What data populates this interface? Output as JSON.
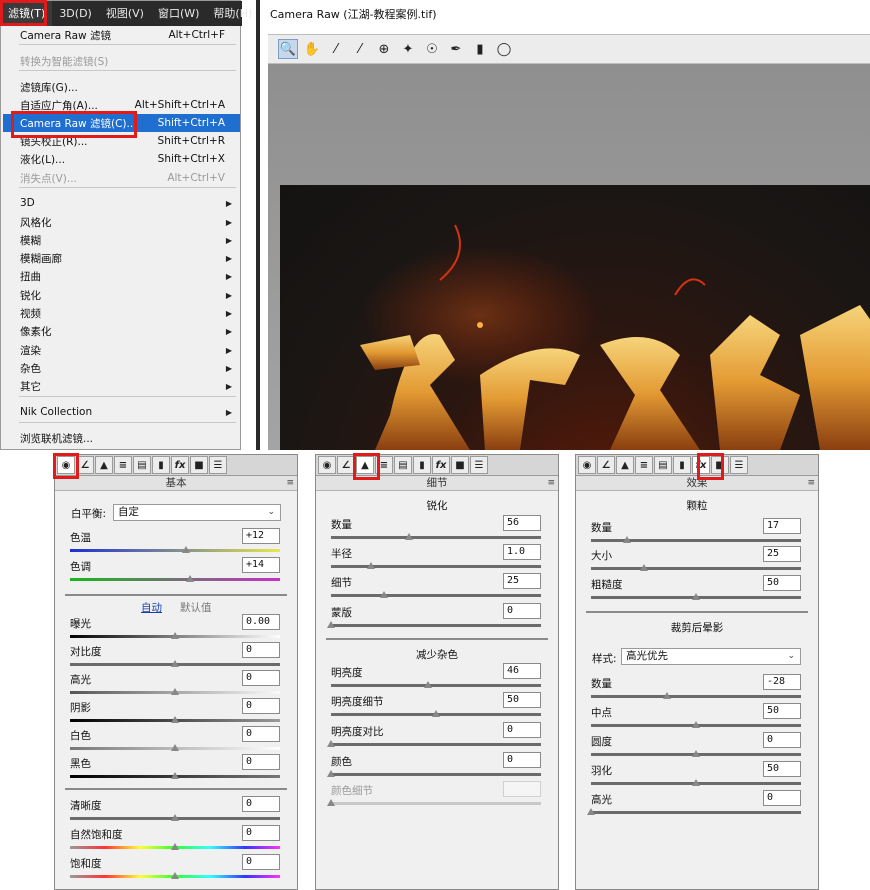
{
  "menubar": {
    "items": [
      "滤镜(T)",
      "3D(D)",
      "视图(V)",
      "窗口(W)",
      "帮助(H)"
    ]
  },
  "menu": {
    "items": [
      {
        "label": "Camera Raw 滤镜",
        "shortcut": "Alt+Ctrl+F",
        "state": "normal"
      },
      {
        "label": "转换为智能滤镜(S)",
        "shortcut": "",
        "state": "disabled"
      },
      {
        "label": "滤镜库(G)...",
        "shortcut": "",
        "state": "normal"
      },
      {
        "label": "自适应广角(A)...",
        "shortcut": "Alt+Shift+Ctrl+A",
        "state": "normal"
      },
      {
        "label": "Camera Raw 滤镜(C)...",
        "shortcut": "Shift+Ctrl+A",
        "state": "highlight"
      },
      {
        "label": "镜头校正(R)...",
        "shortcut": "Shift+Ctrl+R",
        "state": "normal"
      },
      {
        "label": "液化(L)...",
        "shortcut": "Shift+Ctrl+X",
        "state": "normal"
      },
      {
        "label": "消失点(V)...",
        "shortcut": "Alt+Ctrl+V",
        "state": "disabled"
      },
      {
        "label": "3D",
        "submenu": true
      },
      {
        "label": "风格化",
        "submenu": true
      },
      {
        "label": "模糊",
        "submenu": true
      },
      {
        "label": "模糊画廊",
        "submenu": true
      },
      {
        "label": "扭曲",
        "submenu": true
      },
      {
        "label": "锐化",
        "submenu": true
      },
      {
        "label": "视频",
        "submenu": true
      },
      {
        "label": "像素化",
        "submenu": true
      },
      {
        "label": "渲染",
        "submenu": true
      },
      {
        "label": "杂色",
        "submenu": true
      },
      {
        "label": "其它",
        "submenu": true
      },
      {
        "label": "Nik Collection",
        "submenu": true
      },
      {
        "label": "浏览联机滤镜..."
      }
    ]
  },
  "camera_raw": {
    "title": "Camera Raw (江湖-教程案例.tif)",
    "tools": [
      "zoom-icon",
      "hand-icon",
      "white-balance-icon",
      "color-sampler-icon",
      "target-adjust-icon",
      "crop-icon",
      "spot-removal-icon",
      "brush-icon",
      "graduated-filter-icon",
      "radial-filter-icon"
    ]
  },
  "panel_basic": {
    "title": "基本",
    "white_balance_label": "白平衡:",
    "white_balance_value": "自定",
    "auto_label": "自动",
    "default_label": "默认值",
    "sliders": [
      {
        "label": "色温",
        "value": "+12",
        "pos": 0.55
      },
      {
        "label": "色调",
        "value": "+14",
        "pos": 0.57
      },
      {
        "label": "曝光",
        "value": "0.00",
        "pos": 0.5
      },
      {
        "label": "对比度",
        "value": "0",
        "pos": 0.5
      },
      {
        "label": "高光",
        "value": "0",
        "pos": 0.5
      },
      {
        "label": "阴影",
        "value": "0",
        "pos": 0.5
      },
      {
        "label": "白色",
        "value": "0",
        "pos": 0.5
      },
      {
        "label": "黑色",
        "value": "0",
        "pos": 0.5
      },
      {
        "label": "清晰度",
        "value": "0",
        "pos": 0.5
      },
      {
        "label": "自然饱和度",
        "value": "0",
        "pos": 0.5
      },
      {
        "label": "饱和度",
        "value": "0",
        "pos": 0.5
      }
    ]
  },
  "panel_detail": {
    "title": "细节",
    "sharpen_title": "锐化",
    "noise_title": "减少杂色",
    "sharpen": [
      {
        "label": "数量",
        "value": "56",
        "pos": 0.37
      },
      {
        "label": "半径",
        "value": "1.0",
        "pos": 0.19
      },
      {
        "label": "细节",
        "value": "25",
        "pos": 0.25
      },
      {
        "label": "蒙版",
        "value": "0",
        "pos": 0.0
      }
    ],
    "noise": [
      {
        "label": "明亮度",
        "value": "46",
        "pos": 0.46
      },
      {
        "label": "明亮度细节",
        "value": "50",
        "pos": 0.5
      },
      {
        "label": "明亮度对比",
        "value": "0",
        "pos": 0.0
      },
      {
        "label": "颜色",
        "value": "0",
        "pos": 0.0
      },
      {
        "label": "颜色细节",
        "value": "",
        "pos": 0.0,
        "disabled": true
      }
    ]
  },
  "panel_effects": {
    "title": "效果",
    "grain_title": "颗粒",
    "vignette_title": "裁剪后晕影",
    "style_label": "样式:",
    "style_value": "高光优先",
    "grain": [
      {
        "label": "数量",
        "value": "17",
        "pos": 0.17
      },
      {
        "label": "大小",
        "value": "25",
        "pos": 0.25
      },
      {
        "label": "粗糙度",
        "value": "50",
        "pos": 0.5
      }
    ],
    "vignette": [
      {
        "label": "数量",
        "value": "-28",
        "pos": 0.36
      },
      {
        "label": "中点",
        "value": "50",
        "pos": 0.5
      },
      {
        "label": "圆度",
        "value": "0",
        "pos": 0.5
      },
      {
        "label": "羽化",
        "value": "50",
        "pos": 0.5
      },
      {
        "label": "高光",
        "value": "0",
        "pos": 0.0
      }
    ]
  },
  "panel_tabs": [
    "basic-tab-icon",
    "tone-curve-tab-icon",
    "detail-tab-icon",
    "hsl-tab-icon",
    "split-toning-tab-icon",
    "lens-tab-icon",
    "effects-tab-icon",
    "camera-calibration-tab-icon",
    "presets-tab-icon"
  ]
}
